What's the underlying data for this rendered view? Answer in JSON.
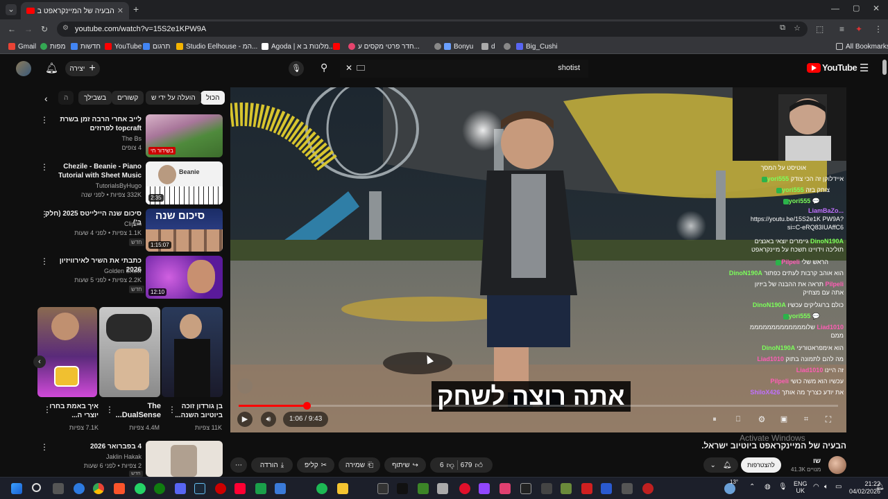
{
  "browser": {
    "tab_title": "הבעיה של המיינקראפט ביוטיוב",
    "url": "youtube.com/watch?v=15S2e1KPW9A",
    "bookmarks": [
      "Gmail",
      "מפות",
      "חדשות",
      "YouTube",
      "תרגום",
      "Studio Eelhouse - המ...",
      "Agoda | מלונות ב א...",
      "חדר פרטי מקסים ע...",
      "Bonyu",
      "d",
      "Big_Cushi"
    ],
    "all_bookmarks": "All Bookmarks"
  },
  "yt_header": {
    "create_label": "יצירה",
    "search_query": "shotist",
    "logo_text": "YouTube"
  },
  "chips": [
    "הכול",
    "הועלה על ידי ש",
    "קשורים",
    "בשבילך",
    "ה"
  ],
  "side_items": [
    {
      "title": "לייב אחרי הרבה זמן בשרת topcraft לפרוזים",
      "channel": "The Bs",
      "meta": "4 צופים",
      "overlay": "בשידור חי"
    },
    {
      "title": "Chezile - Beanie - Piano Tutorial with Sheet Music",
      "channel": "TutorialsByHugo",
      "meta": "332K צפיות • לפני שנה",
      "duration": "2:35"
    },
    {
      "title": "סיכום שנה היילייטס 2025 (חלק ב')",
      "channel": "Clipim",
      "meta": "1.1K צפיות • לפני 4 שעות",
      "duration": "1:15:07",
      "badge": "חדש"
    },
    {
      "title": "כתבתי את השיר לאירוויזיון 2026",
      "channel": "Golden Show",
      "meta": "2.2K צפיות • לפני 5 שעות",
      "duration": "12:10",
      "badge": "חדש"
    }
  ],
  "shorts": [
    {
      "title": "איך באמת בחרו יוצרי ה...",
      "views": "7.1K צפיות"
    },
    {
      "title": "The DualSense...",
      "views": "4.4M צפיות"
    },
    {
      "title": "בן גורדון זוכה ביוטיוב השנה...",
      "views": "11K צפיות"
    }
  ],
  "bottom_item": {
    "title": "4 בפברואר 2026",
    "channel": "Jaklin Hakak",
    "meta": "2 צפיות • לפני 6 שעות",
    "badge": "חדש"
  },
  "player": {
    "subtitle": "אתה רוצה לשחק",
    "time": "1:06 / 9:43",
    "progress": 0.113,
    "activate": "Activate Windows"
  },
  "chat": [
    {
      "name": "",
      "text": "אוטיסט על המסך"
    },
    {
      "name": "yori555",
      "text": "איידלוקן זה הכי צודק"
    },
    {
      "name": "yori555",
      "text": "צוחק בזה"
    },
    {
      "name": "yori555",
      "text": "💬"
    },
    {
      "name": "LiamBaZo...",
      "text": "https://youtu.be/15S2e1K PW9A?si=C-eRQ83IUAffC6"
    },
    {
      "name": "DinoN190A",
      "text": "גיימרים יוצאי באנצים תוליכה וידויינו תשכח על מיינקראפט"
    },
    {
      "name": "Pilpeli",
      "text": "הראש שלי"
    },
    {
      "name": "DinoN190A",
      "text": "הוא אוהב קרבות לעתים כפתור"
    },
    {
      "name": "Pilpeli",
      "text": "תראה את ההבנה של ביזיון אתה עם מצחיק"
    },
    {
      "name": "DinoN190A",
      "text": "כולם ברוגליקים עכשיו"
    },
    {
      "name": "yori555",
      "text": "💬"
    },
    {
      "name": "Liad1010",
      "text": "שלומממממממממממממ ממם"
    },
    {
      "name": "DinoN190A",
      "text": "הוא אימפראטוריני"
    },
    {
      "name": "Liad1010",
      "text": "מה להם לתמונה בתוק"
    },
    {
      "name": "Liad1010",
      "text": "זה היינו"
    },
    {
      "name": "Pilpeli",
      "text": "עכשיו הוא משה כושי"
    },
    {
      "name": "ShiloX426",
      "text": "את יודע כצריך מה אותך"
    }
  ],
  "below": {
    "title": "הבעיה של המיינקראפט ביוטיוב ישראל.",
    "channel": "שו",
    "subs": "41.3K מנויים",
    "subscribe": "להצטרפות",
    "likes": "679",
    "dislikes": "6",
    "share": "שיתוף",
    "save": "שמירה",
    "clip": "קליפ",
    "download": "הורדה"
  },
  "taskbar": {
    "temp": "13°",
    "lang": "ENG",
    "region": "UK",
    "time": "21:22",
    "date": "04/02/2026"
  },
  "colors": {
    "red": "#ff0000",
    "green_badge": "#2bb34a",
    "chat_green": "#7cff5a",
    "chat_pink": "#ff5db5",
    "chat_purple": "#c070ff"
  }
}
